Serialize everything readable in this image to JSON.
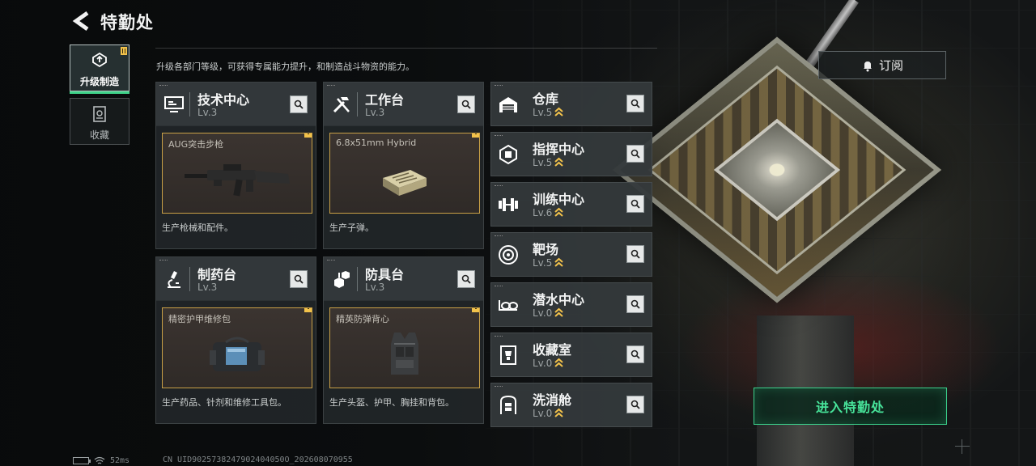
{
  "header": {
    "title": "特勤处",
    "description": "升级各部门等级，可获得专属能力提升，和制造战斗物资的能力。"
  },
  "tabs": [
    {
      "label": "升级制造",
      "icon": "upgrade-icon",
      "active": true,
      "badge": true
    },
    {
      "label": "收藏",
      "icon": "collection-icon",
      "active": false,
      "badge": false
    }
  ],
  "panels": [
    {
      "name": "技术中心",
      "level": "Lv.3",
      "icon": "monitor-icon",
      "craft_item": "AUG突击步枪",
      "craft_art": "rifle-icon",
      "desc": "生产枪械和配件。"
    },
    {
      "name": "工作台",
      "level": "Lv.3",
      "icon": "tools-icon",
      "craft_item": "6.8x51mm Hybrid",
      "craft_art": "ammo-box-icon",
      "desc": "生产子弹。"
    },
    {
      "name": "制药台",
      "level": "Lv.3",
      "icon": "microscope-icon",
      "craft_item": "精密护甲维修包",
      "craft_art": "repair-kit-icon",
      "desc": "生产药品、针剂和维修工具包。"
    },
    {
      "name": "防具台",
      "level": "Lv.3",
      "icon": "cubes-icon",
      "craft_item": "精英防弹背心",
      "craft_art": "vest-icon",
      "desc": "生产头盔、护甲、胸挂和背包。"
    }
  ],
  "stations": [
    {
      "name": "仓库",
      "level": "Lv.5",
      "icon": "warehouse-icon"
    },
    {
      "name": "指挥中心",
      "level": "Lv.5",
      "icon": "chip-icon"
    },
    {
      "name": "训练中心",
      "level": "Lv.6",
      "icon": "dumbbell-icon"
    },
    {
      "name": "靶场",
      "level": "Lv.5",
      "icon": "target-icon"
    },
    {
      "name": "潜水中心",
      "level": "Lv.0",
      "icon": "diving-mask-icon"
    },
    {
      "name": "收藏室",
      "level": "Lv.0",
      "icon": "trophy-icon"
    },
    {
      "name": "洗消舱",
      "level": "Lv.0",
      "icon": "decontamination-icon"
    }
  ],
  "actions": {
    "subscribe": "订阅",
    "enter": "进入特勤处"
  },
  "footer": {
    "ping": "52ms",
    "uid": "CN UID9025738247902404050O_202608070955"
  },
  "colors": {
    "accent_green": "#47e39a",
    "badge_yellow": "#f2c24b",
    "craft_border": "#c9a046",
    "upgrade_arrow": "#f2c24b"
  }
}
